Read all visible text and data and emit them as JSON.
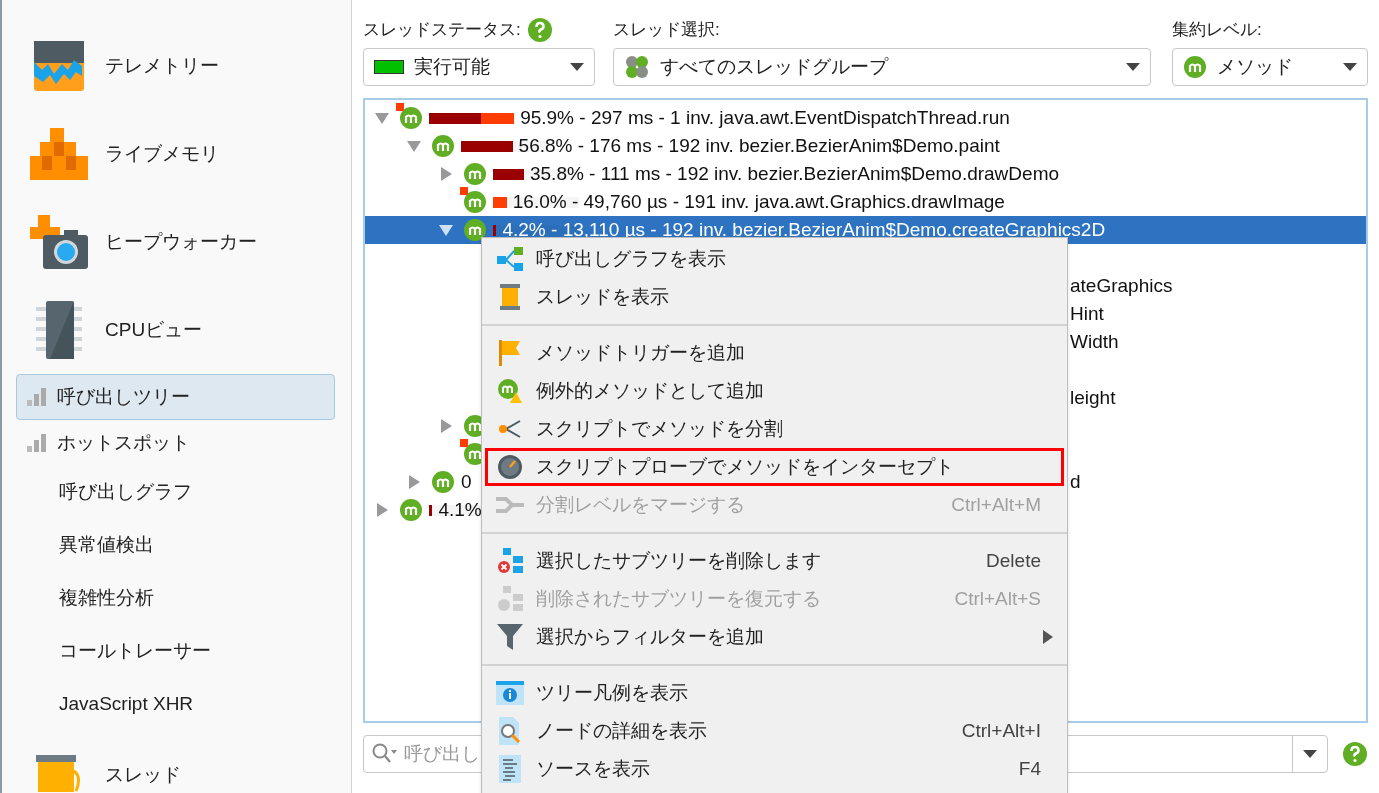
{
  "filters": [
    {
      "kind": "status",
      "label": "スレッドステータス:",
      "help": true,
      "value": "実行可能"
    },
    {
      "kind": "threads",
      "label": "スレッド選択:",
      "value": "すべてのスレッドグループ"
    },
    {
      "kind": "level",
      "label": "集約レベル:",
      "value": "メソッド"
    }
  ],
  "sidebar": [
    {
      "kind": "large",
      "label": "テレメトリー",
      "selected": false
    },
    {
      "kind": "large",
      "label": "ライブメモリ",
      "selected": false
    },
    {
      "kind": "large",
      "label": "ヒープウォーカー",
      "selected": false
    },
    {
      "kind": "large",
      "label": "CPUビュー",
      "selected": false
    },
    {
      "kind": "small",
      "label": "呼び出しツリー",
      "selected": true
    },
    {
      "kind": "small",
      "label": "ホットスポット",
      "selected": false
    },
    {
      "kind": "sub",
      "label": "呼び出しグラフ",
      "selected": false
    },
    {
      "kind": "sub",
      "label": "異常値検出",
      "selected": false
    },
    {
      "kind": "sub",
      "label": "複雑性分析",
      "selected": false
    },
    {
      "kind": "sub",
      "label": "コールトレーサー",
      "selected": false
    },
    {
      "kind": "sub",
      "label": "JavaScript XHR",
      "selected": false
    },
    {
      "kind": "large",
      "label": "スレッド",
      "selected": false
    }
  ],
  "tree": [
    {
      "text": "95.9% - 297 ms - 1 inv. java.awt.EventDispatchThread.run",
      "expanded": true,
      "flagged": true,
      "selected": false,
      "bar": [
        {
          "kind": "dark",
          "level": 0.6
        },
        {
          "kind": "light",
          "level": 0.39
        }
      ],
      "children": [
        {
          "text": "56.8% - 176 ms - 192 inv. bezier.BezierAnim$Demo.paint",
          "expanded": true,
          "flagged": false,
          "selected": false,
          "bar": [
            {
              "kind": "dark",
              "level": 0.6
            }
          ],
          "children": [
            {
              "text": "35.8% - 111 ms - 192 inv. bezier.BezierAnim$Demo.drawDemo",
              "expanded": false,
              "flagged": false,
              "selected": false,
              "bar": [
                {
                  "kind": "dark",
                  "level": 0.36
                }
              ]
            },
            {
              "text": "16.0% - 49,760 µs - 191 inv. java.awt.Graphics.drawImage",
              "flagged": true,
              "selected": false,
              "bar": [
                {
                  "kind": "light",
                  "level": 0.16
                }
              ]
            },
            {
              "text": "4.2% - 13,110 µs - 192 inv. bezier.BezierAnim$Demo.createGraphics2D",
              "expanded": true,
              "flagged": false,
              "selected": true,
              "bar": [
                {
                  "kind": "dark",
                  "level": 0.04
                }
              ],
              "children": [
                {
                  "selected": false
                },
                {
                  "tail": "ateGraphics"
                },
                {
                  "tail": "Hint"
                },
                {
                  "tail": "Width"
                },
                {
                  "selected": false
                },
                {
                  "tail": "leight"
                }
              ]
            },
            {
              "expanded": false,
              "flagged": false,
              "selected": false
            },
            {
              "flagged": true,
              "selected": false
            }
          ]
        },
        {
          "text": "0",
          "tail": "d",
          "expanded": false,
          "flagged": false,
          "selected": false
        }
      ]
    },
    {
      "text": "4.1%",
      "expanded": false,
      "flagged": false,
      "selected": false,
      "bar": [
        {
          "kind": "dark",
          "level": 0.04
        }
      ]
    }
  ],
  "search": {
    "placeholder": "呼び出し"
  },
  "menu": [
    {
      "kind": "item",
      "label": "呼び出しグラフを表示",
      "disabled": false,
      "highlighted": false,
      "submenu": false
    },
    {
      "kind": "item",
      "label": "スレッドを表示",
      "disabled": false,
      "highlighted": false,
      "submenu": false
    },
    {
      "kind": "separator"
    },
    {
      "kind": "item",
      "label": "メソッドトリガーを追加",
      "disabled": false,
      "highlighted": false,
      "submenu": false
    },
    {
      "kind": "item",
      "label": "例外的メソッドとして追加",
      "disabled": false,
      "highlighted": false,
      "submenu": false
    },
    {
      "kind": "item",
      "label": "スクリプトでメソッドを分割",
      "disabled": false,
      "highlighted": false,
      "submenu": false
    },
    {
      "kind": "item",
      "label": "スクリプトプローブでメソッドをインターセプト",
      "disabled": false,
      "highlighted": true,
      "submenu": false
    },
    {
      "kind": "item",
      "label": "分割レベルをマージする",
      "shortcut": "Ctrl+Alt+M",
      "disabled": true,
      "highlighted": false,
      "submenu": false
    },
    {
      "kind": "separator"
    },
    {
      "kind": "item",
      "label": "選択したサブツリーを削除します",
      "shortcut": "Delete",
      "disabled": false,
      "highlighted": false,
      "submenu": false
    },
    {
      "kind": "item",
      "label": "削除されたサブツリーを復元する",
      "shortcut": "Ctrl+Alt+S",
      "disabled": true,
      "highlighted": false,
      "submenu": false
    },
    {
      "kind": "item",
      "label": "選択からフィルターを追加",
      "disabled": false,
      "highlighted": false,
      "submenu": true
    },
    {
      "kind": "separator"
    },
    {
      "kind": "item",
      "label": "ツリー凡例を表示",
      "disabled": false,
      "highlighted": false,
      "submenu": false
    },
    {
      "kind": "item",
      "label": "ノードの詳細を表示",
      "shortcut": "Ctrl+Alt+I",
      "disabled": false,
      "highlighted": false,
      "submenu": false
    },
    {
      "kind": "item",
      "label": "ソースを表示",
      "shortcut": "F4",
      "disabled": false,
      "highlighted": false,
      "submenu": false
    }
  ]
}
